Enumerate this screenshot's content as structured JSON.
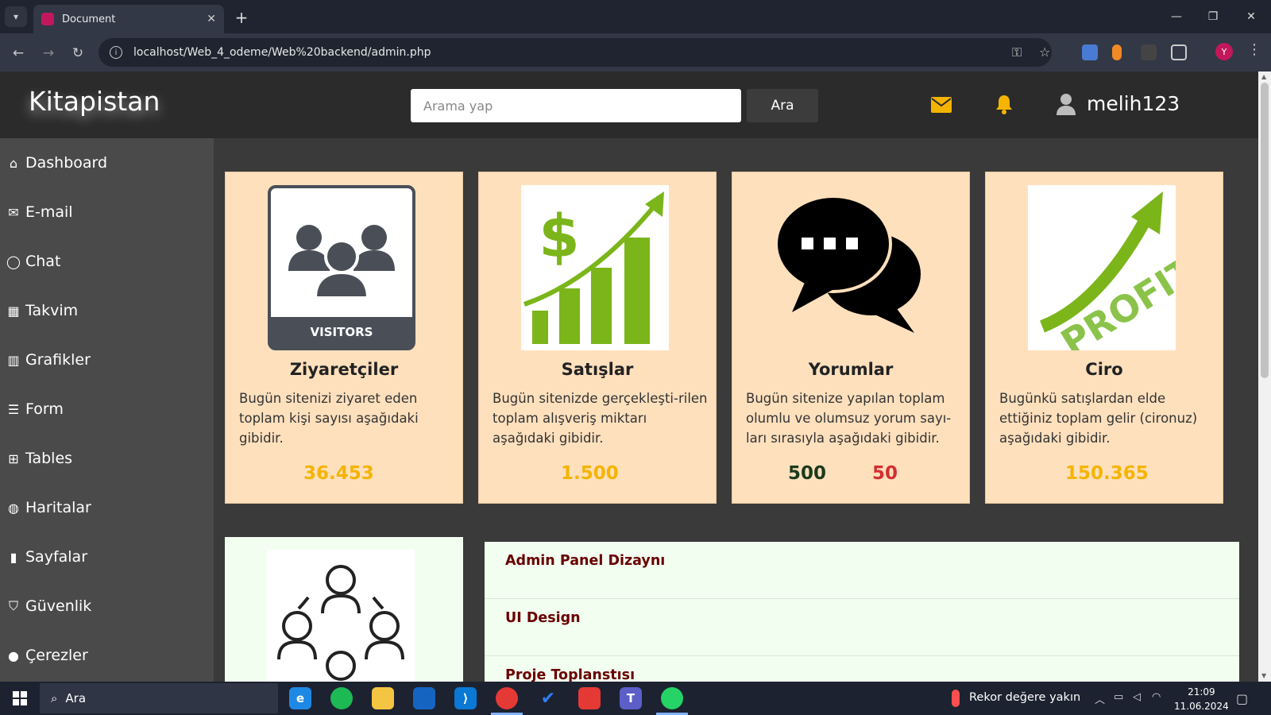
{
  "browser": {
    "tab_title": "Document",
    "url": "localhost/Web_4_odeme/Web%20backend/admin.php",
    "profile_initial": "Y"
  },
  "header": {
    "logo": "Kitapistan",
    "search_placeholder": "Arama yap",
    "search_button": "Ara",
    "username": "melih123"
  },
  "sidebar": {
    "items": [
      {
        "label": "Dashboard",
        "icon": "home-icon"
      },
      {
        "label": "E-mail",
        "icon": "envelope-icon"
      },
      {
        "label": "Chat",
        "icon": "chat-icon"
      },
      {
        "label": "Takvim",
        "icon": "calendar-icon"
      },
      {
        "label": "Grafikler",
        "icon": "bar-chart-icon"
      },
      {
        "label": "Form",
        "icon": "form-icon"
      },
      {
        "label": "Tables",
        "icon": "table-icon"
      },
      {
        "label": "Haritalar",
        "icon": "globe-icon"
      },
      {
        "label": "Sayfalar",
        "icon": "file-icon"
      },
      {
        "label": "Güvenlik",
        "icon": "shield-icon"
      },
      {
        "label": "Çerezler",
        "icon": "cookie-icon"
      }
    ]
  },
  "cards": [
    {
      "title": "Ziyaretçiler",
      "desc": "Bugün sitenizi ziyaret eden toplam kişi sayısı aşağıdaki gibidir.",
      "value": "36.453",
      "image_caption": "VISITORS"
    },
    {
      "title": "Satışlar",
      "desc": "Bugün sitenizde gerçekleşti-rilen toplam alışveriş miktarı aşağıdaki gibidir.",
      "value": "1.500"
    },
    {
      "title": "Yorumlar",
      "desc": "Bugün sitenize yapılan toplam olumlu ve olumsuz yorum sayı-ları sırasıyla aşağıdaki gibidir.",
      "value_positive": "500",
      "value_negative": "50"
    },
    {
      "title": "Ciro",
      "desc": "Bugünkü satışlardan elde ettiğiniz toplam gelir (cironuz) aşağıdaki gibidir.",
      "value": "150.365",
      "image_caption": "PROFIT"
    }
  ],
  "tasks": [
    "Admin Panel Dizaynı",
    "UI Design",
    "Proje Toplanstısı"
  ],
  "taskbar": {
    "search_label": "Ara",
    "weather": "Rekor değere yakın",
    "time": "21:09",
    "date": "11.06.2024"
  },
  "colors": {
    "card_bg": "#ffe0bd",
    "value_yellow": "#f5b400",
    "positive": "#1b3a1b",
    "negative": "#d32f2f",
    "task_text": "#6a0000"
  }
}
